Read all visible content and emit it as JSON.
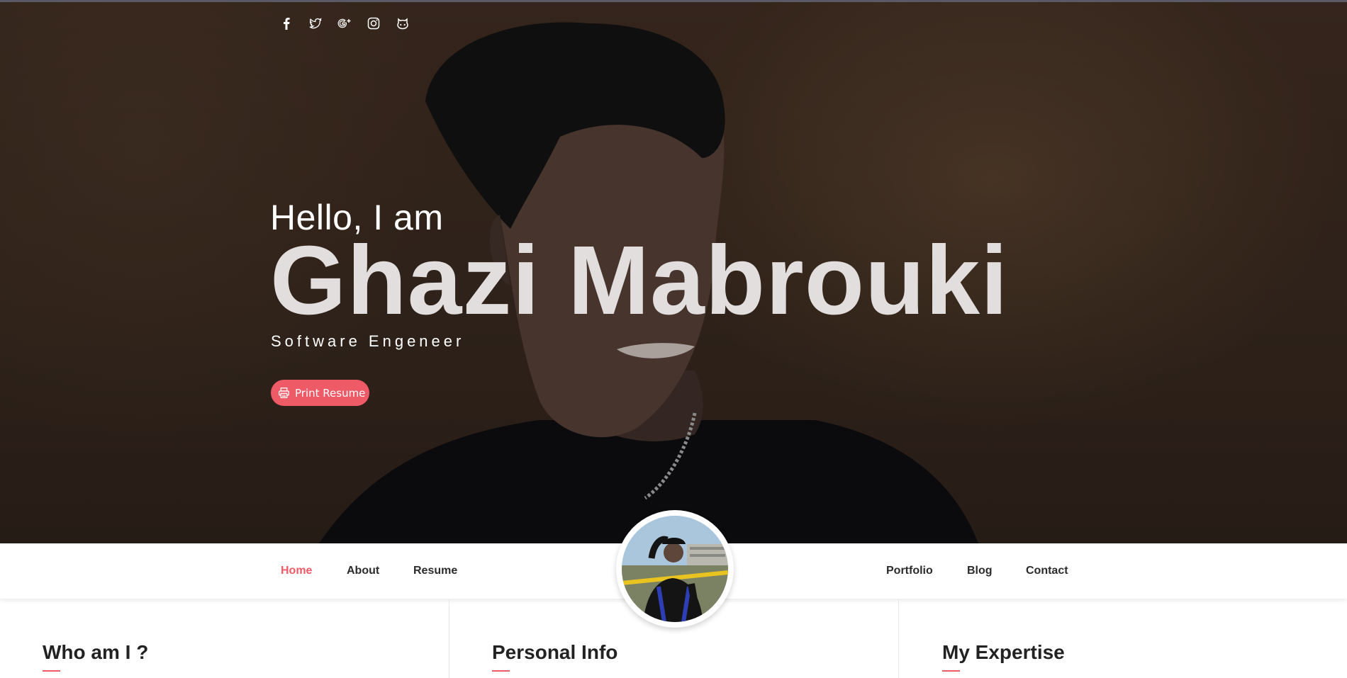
{
  "social": [
    "facebook-icon",
    "twitter-icon",
    "google-plus-icon",
    "instagram-icon",
    "github-icon"
  ],
  "hero": {
    "greeting": "Hello, I am",
    "name": "Ghazi Mabrouki",
    "role": "Software Engeneer",
    "print_button": "Print Resume"
  },
  "nav": {
    "left": [
      "Home",
      "About",
      "Resume"
    ],
    "right": [
      "Portfolio",
      "Blog",
      "Contact"
    ],
    "active": "Home"
  },
  "sections": {
    "about_title": "Who am I ?",
    "info_title": "Personal Info",
    "expertise_title": "My Expertise"
  },
  "colors": {
    "accent": "#ef5a67",
    "hero_bg": "#33251c"
  }
}
